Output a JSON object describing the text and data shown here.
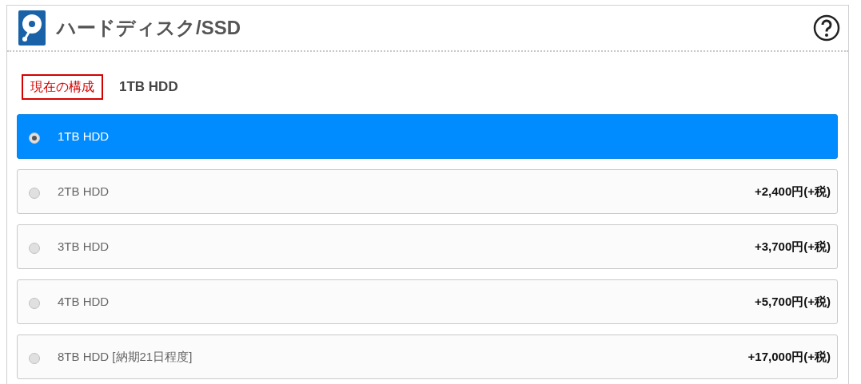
{
  "header": {
    "title": "ハードディスク/SSD"
  },
  "current": {
    "label": "現在の構成",
    "value": "1TB HDD"
  },
  "options": [
    {
      "label": "1TB HDD",
      "selected": true
    },
    {
      "label": "2TB HDD",
      "price": "+2,400円(+税)",
      "selected": false
    },
    {
      "label": "3TB HDD",
      "price": "+3,700円(+税)",
      "selected": false
    },
    {
      "label": "4TB HDD",
      "price": "+5,700円(+税)",
      "selected": false
    },
    {
      "label": "8TB HDD [納期21日程度]",
      "price": "+17,000円(+税)",
      "selected": false
    }
  ]
}
